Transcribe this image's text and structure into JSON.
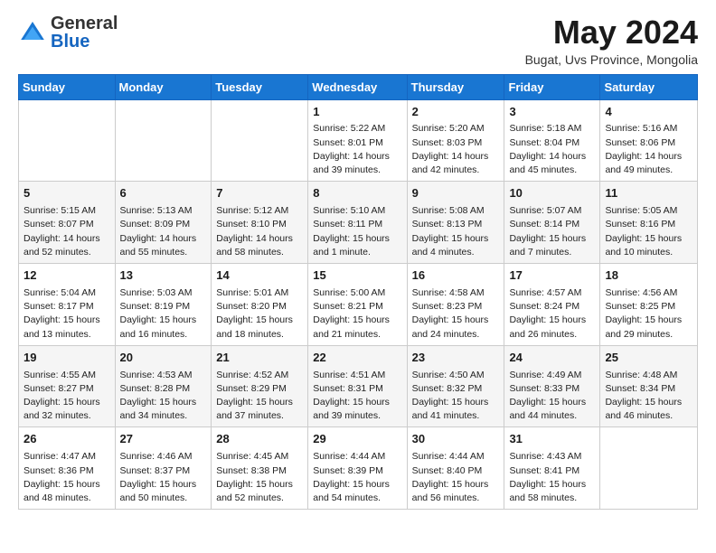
{
  "logo": {
    "general": "General",
    "blue": "Blue"
  },
  "title": "May 2024",
  "location": "Bugat, Uvs Province, Mongolia",
  "weekdays": [
    "Sunday",
    "Monday",
    "Tuesday",
    "Wednesday",
    "Thursday",
    "Friday",
    "Saturday"
  ],
  "weeks": [
    [
      {
        "day": "",
        "info": ""
      },
      {
        "day": "",
        "info": ""
      },
      {
        "day": "",
        "info": ""
      },
      {
        "day": "1",
        "info": "Sunrise: 5:22 AM\nSunset: 8:01 PM\nDaylight: 14 hours\nand 39 minutes."
      },
      {
        "day": "2",
        "info": "Sunrise: 5:20 AM\nSunset: 8:03 PM\nDaylight: 14 hours\nand 42 minutes."
      },
      {
        "day": "3",
        "info": "Sunrise: 5:18 AM\nSunset: 8:04 PM\nDaylight: 14 hours\nand 45 minutes."
      },
      {
        "day": "4",
        "info": "Sunrise: 5:16 AM\nSunset: 8:06 PM\nDaylight: 14 hours\nand 49 minutes."
      }
    ],
    [
      {
        "day": "5",
        "info": "Sunrise: 5:15 AM\nSunset: 8:07 PM\nDaylight: 14 hours\nand 52 minutes."
      },
      {
        "day": "6",
        "info": "Sunrise: 5:13 AM\nSunset: 8:09 PM\nDaylight: 14 hours\nand 55 minutes."
      },
      {
        "day": "7",
        "info": "Sunrise: 5:12 AM\nSunset: 8:10 PM\nDaylight: 14 hours\nand 58 minutes."
      },
      {
        "day": "8",
        "info": "Sunrise: 5:10 AM\nSunset: 8:11 PM\nDaylight: 15 hours\nand 1 minute."
      },
      {
        "day": "9",
        "info": "Sunrise: 5:08 AM\nSunset: 8:13 PM\nDaylight: 15 hours\nand 4 minutes."
      },
      {
        "day": "10",
        "info": "Sunrise: 5:07 AM\nSunset: 8:14 PM\nDaylight: 15 hours\nand 7 minutes."
      },
      {
        "day": "11",
        "info": "Sunrise: 5:05 AM\nSunset: 8:16 PM\nDaylight: 15 hours\nand 10 minutes."
      }
    ],
    [
      {
        "day": "12",
        "info": "Sunrise: 5:04 AM\nSunset: 8:17 PM\nDaylight: 15 hours\nand 13 minutes."
      },
      {
        "day": "13",
        "info": "Sunrise: 5:03 AM\nSunset: 8:19 PM\nDaylight: 15 hours\nand 16 minutes."
      },
      {
        "day": "14",
        "info": "Sunrise: 5:01 AM\nSunset: 8:20 PM\nDaylight: 15 hours\nand 18 minutes."
      },
      {
        "day": "15",
        "info": "Sunrise: 5:00 AM\nSunset: 8:21 PM\nDaylight: 15 hours\nand 21 minutes."
      },
      {
        "day": "16",
        "info": "Sunrise: 4:58 AM\nSunset: 8:23 PM\nDaylight: 15 hours\nand 24 minutes."
      },
      {
        "day": "17",
        "info": "Sunrise: 4:57 AM\nSunset: 8:24 PM\nDaylight: 15 hours\nand 26 minutes."
      },
      {
        "day": "18",
        "info": "Sunrise: 4:56 AM\nSunset: 8:25 PM\nDaylight: 15 hours\nand 29 minutes."
      }
    ],
    [
      {
        "day": "19",
        "info": "Sunrise: 4:55 AM\nSunset: 8:27 PM\nDaylight: 15 hours\nand 32 minutes."
      },
      {
        "day": "20",
        "info": "Sunrise: 4:53 AM\nSunset: 8:28 PM\nDaylight: 15 hours\nand 34 minutes."
      },
      {
        "day": "21",
        "info": "Sunrise: 4:52 AM\nSunset: 8:29 PM\nDaylight: 15 hours\nand 37 minutes."
      },
      {
        "day": "22",
        "info": "Sunrise: 4:51 AM\nSunset: 8:31 PM\nDaylight: 15 hours\nand 39 minutes."
      },
      {
        "day": "23",
        "info": "Sunrise: 4:50 AM\nSunset: 8:32 PM\nDaylight: 15 hours\nand 41 minutes."
      },
      {
        "day": "24",
        "info": "Sunrise: 4:49 AM\nSunset: 8:33 PM\nDaylight: 15 hours\nand 44 minutes."
      },
      {
        "day": "25",
        "info": "Sunrise: 4:48 AM\nSunset: 8:34 PM\nDaylight: 15 hours\nand 46 minutes."
      }
    ],
    [
      {
        "day": "26",
        "info": "Sunrise: 4:47 AM\nSunset: 8:36 PM\nDaylight: 15 hours\nand 48 minutes."
      },
      {
        "day": "27",
        "info": "Sunrise: 4:46 AM\nSunset: 8:37 PM\nDaylight: 15 hours\nand 50 minutes."
      },
      {
        "day": "28",
        "info": "Sunrise: 4:45 AM\nSunset: 8:38 PM\nDaylight: 15 hours\nand 52 minutes."
      },
      {
        "day": "29",
        "info": "Sunrise: 4:44 AM\nSunset: 8:39 PM\nDaylight: 15 hours\nand 54 minutes."
      },
      {
        "day": "30",
        "info": "Sunrise: 4:44 AM\nSunset: 8:40 PM\nDaylight: 15 hours\nand 56 minutes."
      },
      {
        "day": "31",
        "info": "Sunrise: 4:43 AM\nSunset: 8:41 PM\nDaylight: 15 hours\nand 58 minutes."
      },
      {
        "day": "",
        "info": ""
      }
    ]
  ]
}
